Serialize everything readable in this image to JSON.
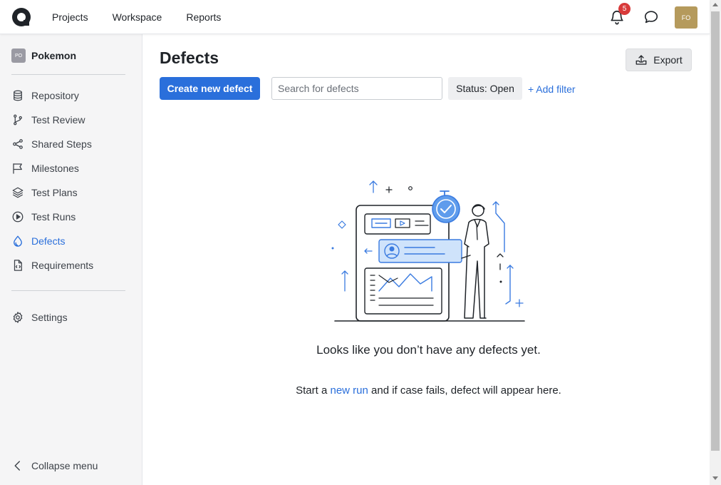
{
  "topnav": {
    "logo": "qase-logo-icon",
    "items": [
      "Projects",
      "Workspace",
      "Reports"
    ],
    "notification_count": "5",
    "avatar_initials": "FO"
  },
  "sidebar": {
    "project_badge": "PO",
    "project_name": "Pokemon",
    "items": [
      {
        "label": "Repository",
        "icon": "database-icon"
      },
      {
        "label": "Test Review",
        "icon": "branch-icon"
      },
      {
        "label": "Shared Steps",
        "icon": "share-icon"
      },
      {
        "label": "Milestones",
        "icon": "flag-icon"
      },
      {
        "label": "Test Plans",
        "icon": "layers-icon"
      },
      {
        "label": "Test Runs",
        "icon": "play-circle-icon"
      },
      {
        "label": "Defects",
        "icon": "bug-drop-icon",
        "active": true
      },
      {
        "label": "Requirements",
        "icon": "file-code-icon"
      }
    ],
    "settings_label": "Settings",
    "collapse_label": "Collapse menu"
  },
  "main": {
    "title": "Defects",
    "export_label": "Export",
    "create_label": "Create new defect",
    "search_placeholder": "Search for defects",
    "status_filter": "Status: Open",
    "add_filter": "+ Add filter",
    "empty_title": "Looks like you don’t have any defects yet.",
    "empty_sub_before": "Start a",
    "empty_sub_link": "new run",
    "empty_sub_after": "and if case fails, defect will appear here."
  },
  "colors": {
    "accent": "#2a6fdb",
    "badge": "#d83a3a",
    "avatar": "#b59a5c"
  }
}
